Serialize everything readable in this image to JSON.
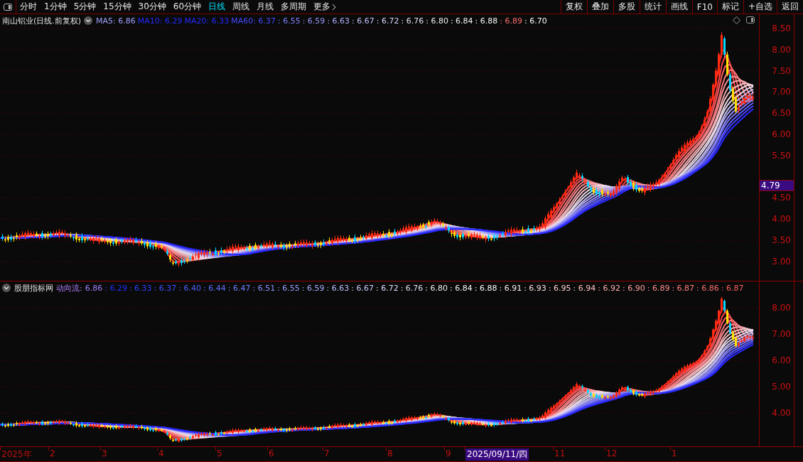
{
  "toolbar": {
    "periods": [
      {
        "label": "分时",
        "selected": false
      },
      {
        "label": "1分钟",
        "selected": false
      },
      {
        "label": "5分钟",
        "selected": false
      },
      {
        "label": "15分钟",
        "selected": false
      },
      {
        "label": "30分钟",
        "selected": false
      },
      {
        "label": "60分钟",
        "selected": false
      },
      {
        "label": "日线",
        "selected": true
      },
      {
        "label": "周线",
        "selected": false
      },
      {
        "label": "月线",
        "selected": false
      },
      {
        "label": "多周期",
        "selected": false
      },
      {
        "label": "更多",
        "selected": false
      }
    ],
    "buttons": [
      "复权",
      "叠加",
      "多股",
      "统计",
      "画线",
      "F10",
      "标记",
      "+自选",
      "返回"
    ]
  },
  "main_pane": {
    "title": "南山铝业(日线.前复权)",
    "legend": [
      {
        "text": "MA5: 6.86",
        "color": "#a0a0ff"
      },
      {
        "text": "MA10: 6.29",
        "color": "#2828ff"
      },
      {
        "text": "MA20: 6.33",
        "color": "#2828ff"
      },
      {
        "text": "MA60: 6.37",
        "color": "#4848ff"
      },
      {
        "text": ": 6.55",
        "color": "#8080ff"
      },
      {
        "text": ": 6.59",
        "color": "#9898ff"
      },
      {
        "text": ": 6.63",
        "color": "#b0b0ff"
      },
      {
        "text": ": 6.67",
        "color": "#c4c4ff"
      },
      {
        "text": ": 6.72",
        "color": "#d8d8ff"
      },
      {
        "text": ": 6.76",
        "color": "#e4e4f4"
      },
      {
        "text": ": 6.80",
        "color": "#f0f0f0"
      },
      {
        "text": ": 6.84",
        "color": "#f4f4f4"
      },
      {
        "text": ": 6.88",
        "color": "#f8f8f8"
      },
      {
        "text": ": 6.89",
        "color": "#ff6e6e"
      },
      {
        "text": ": 6.70",
        "color": "#ffffff"
      }
    ],
    "axis": [
      {
        "label": "8.50"
      },
      {
        "label": "8.00"
      },
      {
        "label": "7.50"
      },
      {
        "label": "7.00"
      },
      {
        "label": "6.50"
      },
      {
        "label": "6.00"
      },
      {
        "label": "5.50"
      },
      {
        "label": "4.50"
      },
      {
        "label": "4.00"
      },
      {
        "label": "3.50"
      },
      {
        "label": "3.00"
      }
    ],
    "cursor_price": {
      "label": "4.79"
    }
  },
  "indicator_pane": {
    "title": "股朋指标网",
    "name": "动向流:",
    "legend": [
      {
        "text": "6.86",
        "color": "#a080ff"
      },
      {
        "text": ": 6.29",
        "color": "#2030ff"
      },
      {
        "text": ": 6.33",
        "color": "#3040ff"
      },
      {
        "text": ": 6.37",
        "color": "#4050ff"
      },
      {
        "text": ": 6.40",
        "color": "#5060ff"
      },
      {
        "text": ": 6.44",
        "color": "#6070ff"
      },
      {
        "text": ": 6.47",
        "color": "#7080ff"
      },
      {
        "text": ": 6.51",
        "color": "#8890ff"
      },
      {
        "text": ": 6.55",
        "color": "#9aa0ff"
      },
      {
        "text": ": 6.59",
        "color": "#aab0ff"
      },
      {
        "text": ": 6.63",
        "color": "#bcc0ff"
      },
      {
        "text": ": 6.67",
        "color": "#ccd0ff"
      },
      {
        "text": ": 6.72",
        "color": "#dde0ff"
      },
      {
        "text": ": 6.76",
        "color": "#e0e0f0"
      },
      {
        "text": ": 6.80",
        "color": "#f0f0f0"
      },
      {
        "text": ": 6.84",
        "color": "#f8f8f8"
      },
      {
        "text": ": 6.88",
        "color": "#ffffff"
      },
      {
        "text": ": 6.91",
        "color": "#fff0f0"
      },
      {
        "text": ": 6.93",
        "color": "#ffe0e0"
      },
      {
        "text": ": 6.95",
        "color": "#ffd0d0"
      },
      {
        "text": ": 6.94",
        "color": "#ffc0c0"
      },
      {
        "text": ": 6.92",
        "color": "#ffb0b0"
      },
      {
        "text": ": 6.90",
        "color": "#ffa0a0"
      },
      {
        "text": ": 6.89",
        "color": "#ff9090"
      },
      {
        "text": ": 6.87",
        "color": "#ff8080"
      },
      {
        "text": ": 6.86",
        "color": "#ff7070"
      },
      {
        "text": ": 6.87",
        "color": "#ff6060"
      }
    ],
    "axis": [
      {
        "label": "8.00"
      },
      {
        "label": "7.00"
      },
      {
        "label": "6.00"
      },
      {
        "label": "5.00"
      },
      {
        "label": "4.00"
      }
    ]
  },
  "date_axis": [
    {
      "label": "2025年",
      "cursor": false
    },
    {
      "label": "2",
      "cursor": false
    },
    {
      "label": "3",
      "cursor": false
    },
    {
      "label": "4",
      "cursor": false
    },
    {
      "label": "5",
      "cursor": false
    },
    {
      "label": "6",
      "cursor": false
    },
    {
      "label": "7",
      "cursor": false
    },
    {
      "label": "8",
      "cursor": false
    },
    {
      "label": "9",
      "cursor": false
    },
    {
      "label": "2025/09/11/四",
      "cursor": true
    },
    {
      "label": "11",
      "cursor": false
    },
    {
      "label": "12",
      "cursor": false
    },
    {
      "label": "1",
      "cursor": false
    }
  ]
}
